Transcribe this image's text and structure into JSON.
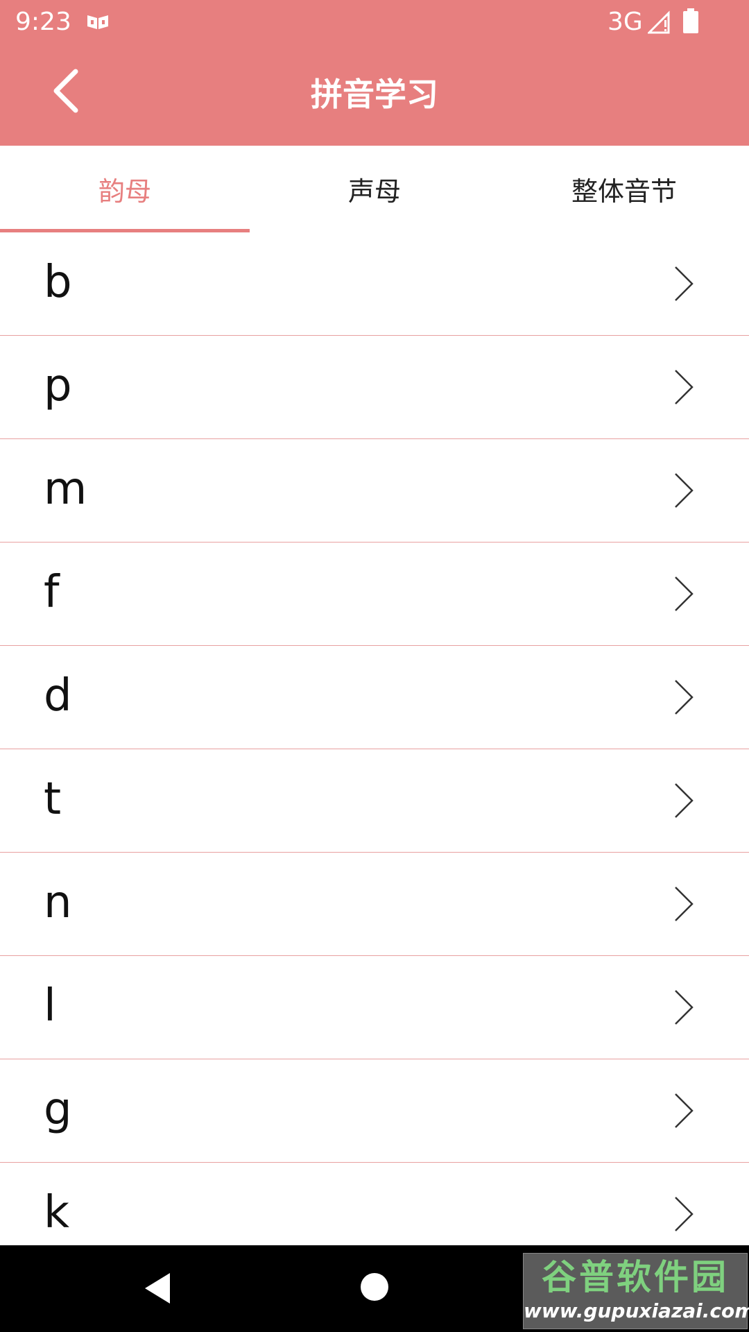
{
  "status_bar": {
    "time": "9:23",
    "network": "3G"
  },
  "app_bar": {
    "title": "拼音学习"
  },
  "tabs": [
    {
      "label": "韵母",
      "active": true
    },
    {
      "label": "声母",
      "active": false
    },
    {
      "label": "整体音节",
      "active": false
    }
  ],
  "list": {
    "items": [
      "b",
      "p",
      "m",
      "f",
      "d",
      "t",
      "n",
      "l",
      "g",
      "k"
    ]
  },
  "watermark": {
    "brand": "谷普软件园",
    "url": "www.gupuxiazai.com"
  },
  "colors": {
    "accent": "#e77f7f",
    "divider": "#e8a0a0",
    "nav_bar": "#000000"
  }
}
